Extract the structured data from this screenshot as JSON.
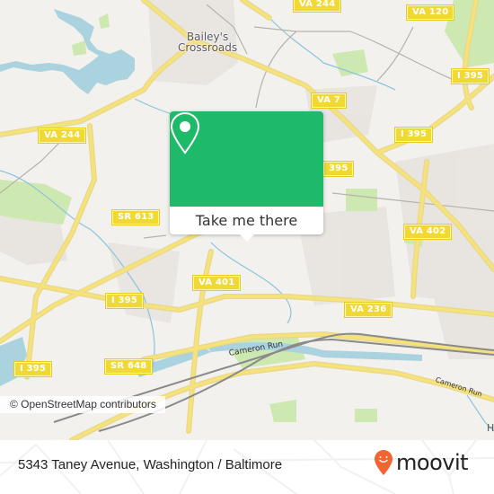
{
  "map": {
    "place_labels": [
      {
        "id": "baileys-crossroads",
        "line1": "Bailey's",
        "line2": "Crossroads"
      }
    ],
    "road_shields": [
      {
        "id": "va-244-top",
        "label": "VA 244"
      },
      {
        "id": "va-120",
        "label": "VA 120"
      },
      {
        "id": "i-395-top-right",
        "label": "I 395"
      },
      {
        "id": "va-7",
        "label": "VA 7"
      },
      {
        "id": "va-244-left",
        "label": "VA 244"
      },
      {
        "id": "i-395-mid",
        "label": "I 395"
      },
      {
        "id": "i-395-center",
        "label": "395"
      },
      {
        "id": "sr-613",
        "label": "SR 613"
      },
      {
        "id": "va-402",
        "label": "VA 402"
      },
      {
        "id": "va-401",
        "label": "VA 401"
      },
      {
        "id": "i-395-left",
        "label": "I 395"
      },
      {
        "id": "va-236",
        "label": "VA 236"
      },
      {
        "id": "i-395-bottom-left",
        "label": "I 395"
      },
      {
        "id": "sr-648",
        "label": "SR 648"
      }
    ],
    "water_labels": [
      {
        "id": "cameron-run",
        "label": "Cameron Run"
      },
      {
        "id": "cameron-run-east",
        "label": "Cameron Run"
      }
    ],
    "edge_label": "H",
    "attribution": "© OpenStreetMap contributors"
  },
  "popup": {
    "icon": "map-pin-icon",
    "action_label": "Take me there",
    "accent_color": "#1fb96a"
  },
  "footer": {
    "address": "5343 Taney Avenue, Washington / Baltimore",
    "brand": "moovit",
    "brand_color": "#f26430"
  }
}
